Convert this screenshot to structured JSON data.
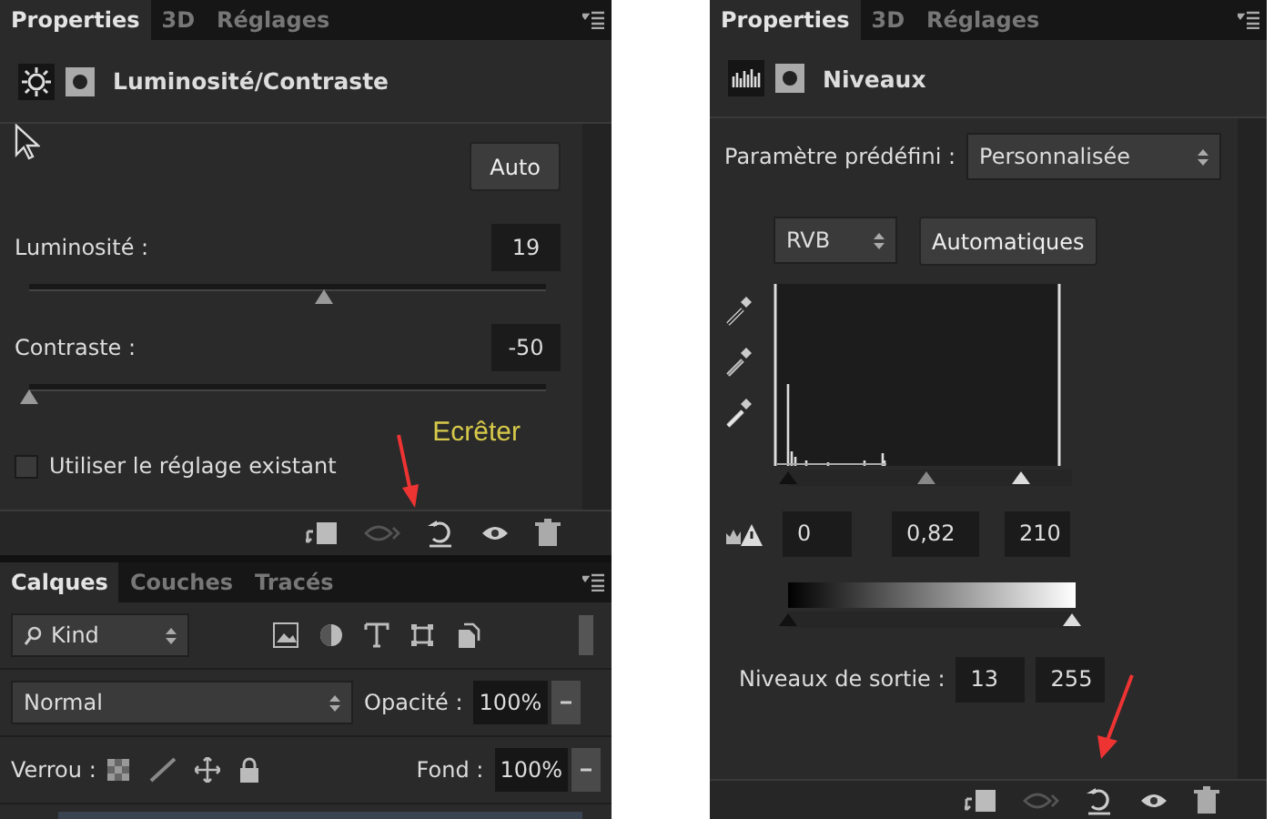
{
  "properties_left": {
    "tabs": [
      {
        "label": "Properties",
        "selected": true
      },
      {
        "label": "3D",
        "selected": false
      },
      {
        "label": "Réglages",
        "selected": false
      }
    ],
    "title": "Luminosité/Contraste",
    "auto_button": "Auto",
    "sliders": [
      {
        "label": "Luminosité :",
        "value": "19",
        "level": 0.57
      },
      {
        "label": "Contraste :",
        "value": "-50",
        "level": 0
      }
    ],
    "checkbox": {
      "label": "Utiliser le réglage existant",
      "checked": false
    },
    "annotation": "Ecrêter"
  },
  "layers": {
    "tabs": [
      {
        "label": "Calques",
        "selected": true
      },
      {
        "label": "Couches",
        "selected": false
      },
      {
        "label": "Tracés",
        "selected": false
      }
    ],
    "filter": "Kind",
    "blend_mode": "Normal",
    "opacity_label": "Opacité :",
    "opacity": "100%",
    "lock_label": "Verrou :",
    "fill_label": "Fond :",
    "fill": "100%"
  },
  "properties_right": {
    "tabs": [
      {
        "label": "Properties",
        "selected": true
      },
      {
        "label": "3D",
        "selected": false
      },
      {
        "label": "Réglages",
        "selected": false
      }
    ],
    "title": "Niveaux",
    "preset_label": "Paramètre prédéfini :",
    "preset": "Personnalisée",
    "channel": "RVB",
    "auto_button": "Automatiques",
    "input_sliders": [
      {
        "level": 0
      },
      {
        "level": 0.49
      },
      {
        "level": 0.82
      }
    ],
    "input_values": [
      "0",
      "0,82",
      "210"
    ],
    "output_sliders": [
      {
        "level": 0
      },
      {
        "level": 1
      }
    ],
    "output_label": "Niveaux de sortie :",
    "output_values": [
      "13",
      "255"
    ]
  }
}
